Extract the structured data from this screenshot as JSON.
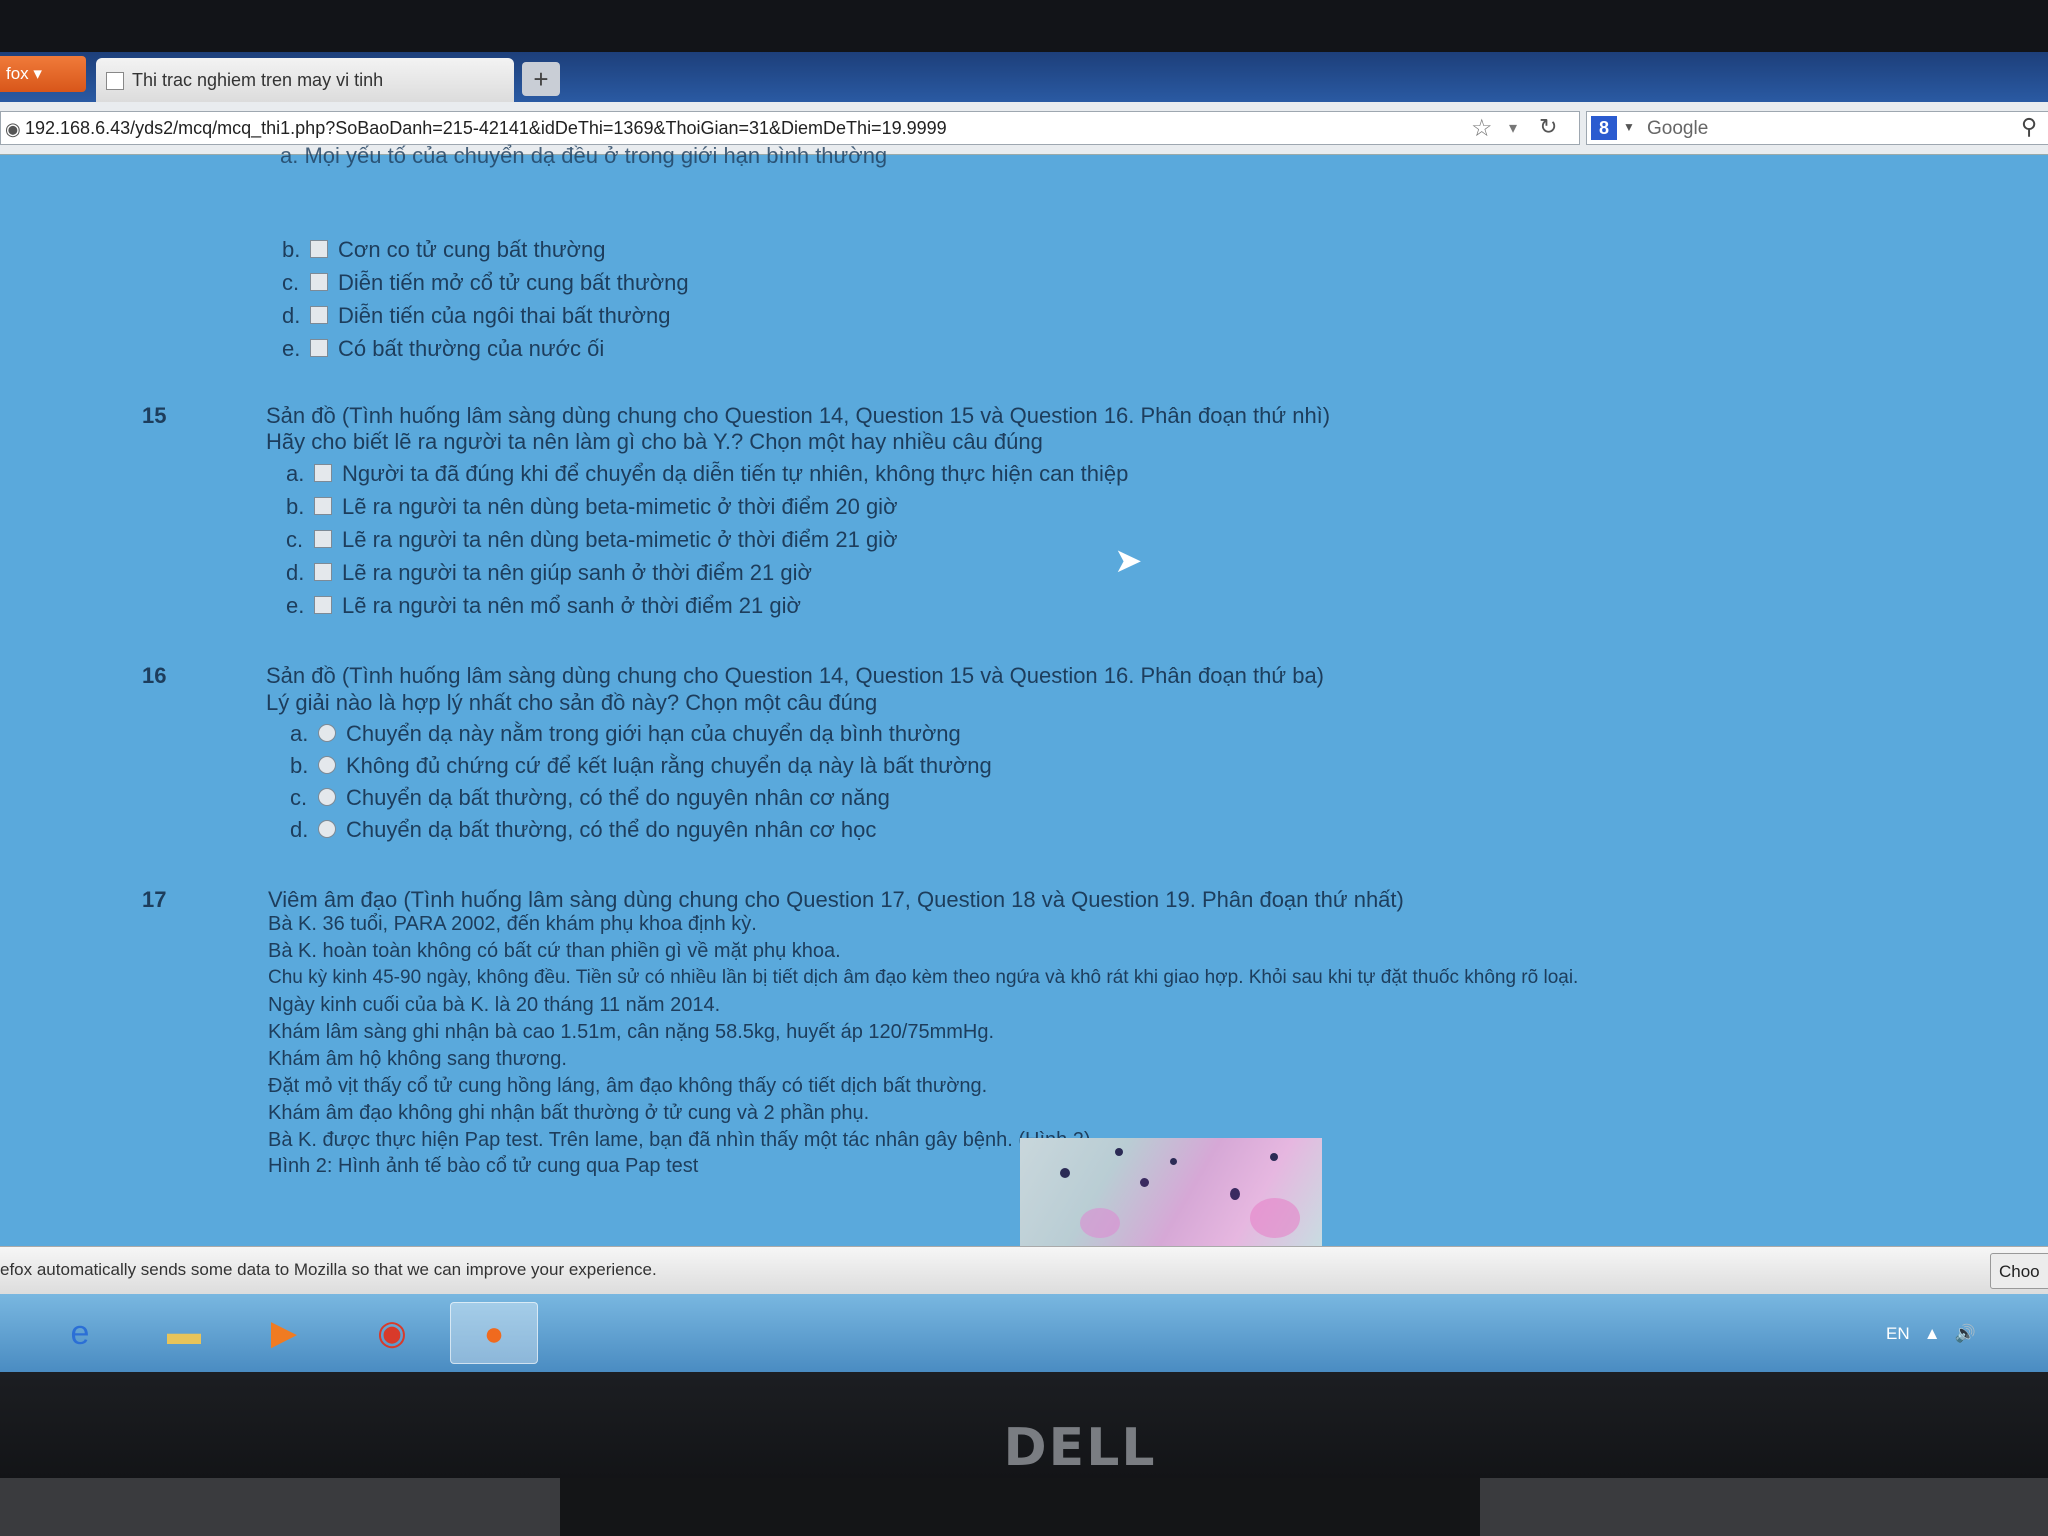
{
  "browser": {
    "menu_label": "fox",
    "tab_title": "Thi trac nghiem tren may vi tinh",
    "new_tab_label": "+",
    "url": "192.168.6.43/yds2/mcq/mcq_thi1.php?SoBaoDanh=215-42141&idDeThi=1369&ThoiGian=31&DiemDeThi=19.9999",
    "search_engine": "8",
    "search_placeholder": "Google"
  },
  "prev_question": {
    "cutoff_text": "a. Mọi yếu tố của chuyển dạ đều ở trong giới hạn bình thường",
    "options": [
      {
        "letter": "b.",
        "text": "Cơn co tử cung bất thường"
      },
      {
        "letter": "c.",
        "text": "Diễn tiến mở cổ tử cung bất thường"
      },
      {
        "letter": "d.",
        "text": "Diễn tiến của ngôi thai bất thường"
      },
      {
        "letter": "e.",
        "text": "Có bất thường của nước ối"
      }
    ]
  },
  "q15": {
    "number": "15",
    "title": "Sản đồ (Tình huống lâm sàng dùng chung cho Question 14, Question 15 và Question 16. Phân đoạn thứ nhì)",
    "prompt": "Hãy cho biết lẽ ra người ta nên làm gì cho bà Y.? Chọn một hay nhiều câu đúng",
    "options": [
      {
        "letter": "a.",
        "text": "Người ta đã đúng khi để chuyển dạ diễn tiến tự nhiên, không thực hiện can thiệp"
      },
      {
        "letter": "b.",
        "text": "Lẽ ra người ta nên dùng beta-mimetic ở thời điểm 20 giờ"
      },
      {
        "letter": "c.",
        "text": "Lẽ ra người ta nên dùng beta-mimetic ở thời điểm 21 giờ"
      },
      {
        "letter": "d.",
        "text": "Lẽ ra người ta nên giúp sanh ở thời điểm 21 giờ"
      },
      {
        "letter": "e.",
        "text": "Lẽ ra người ta nên mổ sanh ở thời điểm 21 giờ"
      }
    ]
  },
  "q16": {
    "number": "16",
    "title": "Sản đồ (Tình huống lâm sàng dùng chung cho Question 14, Question 15 và Question 16. Phân đoạn thứ ba)",
    "prompt": "Lý giải nào là hợp lý nhất cho sản đồ này? Chọn một câu đúng",
    "options": [
      {
        "letter": "a.",
        "text": "Chuyển dạ này nằm trong giới hạn của chuyển dạ bình thường"
      },
      {
        "letter": "b.",
        "text": "Không đủ chứng cứ để kết luận rằng chuyển dạ này là bất thường"
      },
      {
        "letter": "c.",
        "text": "Chuyển dạ bất thường, có thể do nguyên nhân cơ năng"
      },
      {
        "letter": "d.",
        "text": "Chuyển dạ bất thường, có thể do nguyên nhân cơ học"
      }
    ]
  },
  "q17": {
    "number": "17",
    "title": "Viêm âm đạo (Tình huống lâm sàng dùng chung cho Question 17, Question 18 và Question 19. Phân đoạn thứ nhất)",
    "lines": [
      "Bà K. 36 tuổi, PARA 2002, đến khám phụ khoa định kỳ.",
      "Bà K. hoàn toàn không có bất cứ than phiền gì về mặt phụ khoa.",
      "Chu kỳ kinh 45-90 ngày, không đều. Tiền sử có nhiều lần bị tiết dịch âm đạo kèm theo ngứa và khô rát khi giao hợp. Khỏi sau khi tự đặt thuốc không rõ loại.",
      "Ngày kinh cuối của bà K. là 20 tháng 11 năm 2014.",
      "Khám lâm sàng ghi nhận bà cao 1.51m, cân nặng 58.5kg, huyết áp 120/75mmHg.",
      "Khám âm hộ không sang thương.",
      "Đặt mỏ vịt thấy cổ tử cung hồng láng, âm đạo không thấy có tiết dịch bất thường.",
      "Khám âm đạo không ghi nhận bất thường ở tử cung và 2 phần phụ.",
      "Bà K. được thực hiện Pap test. Trên lame, bạn đã nhìn thấy một tác nhân gây bệnh. (Hình 2)",
      "Hình 2: Hình ảnh tế bào cổ tử cung qua Pap test"
    ]
  },
  "notification": {
    "message": "efox automatically sends some data to Mozilla so that we can improve your experience.",
    "button": "Choo"
  },
  "taskbar": {
    "lang": "EN"
  },
  "monitor": {
    "brand": "DELL"
  },
  "icons": [
    "globe-icon",
    "star-icon",
    "reload-icon",
    "search-icon",
    "ie-icon",
    "folder-icon",
    "media-player-icon",
    "chrome-icon",
    "firefox-icon",
    "volume-icon",
    "mouse-cursor-icon"
  ],
  "colors": {
    "page_bg": "#5aa9dc",
    "text": "#1d3d5c",
    "tabbar": "#2a5aa3",
    "firefox_menu": "#e8652a"
  }
}
